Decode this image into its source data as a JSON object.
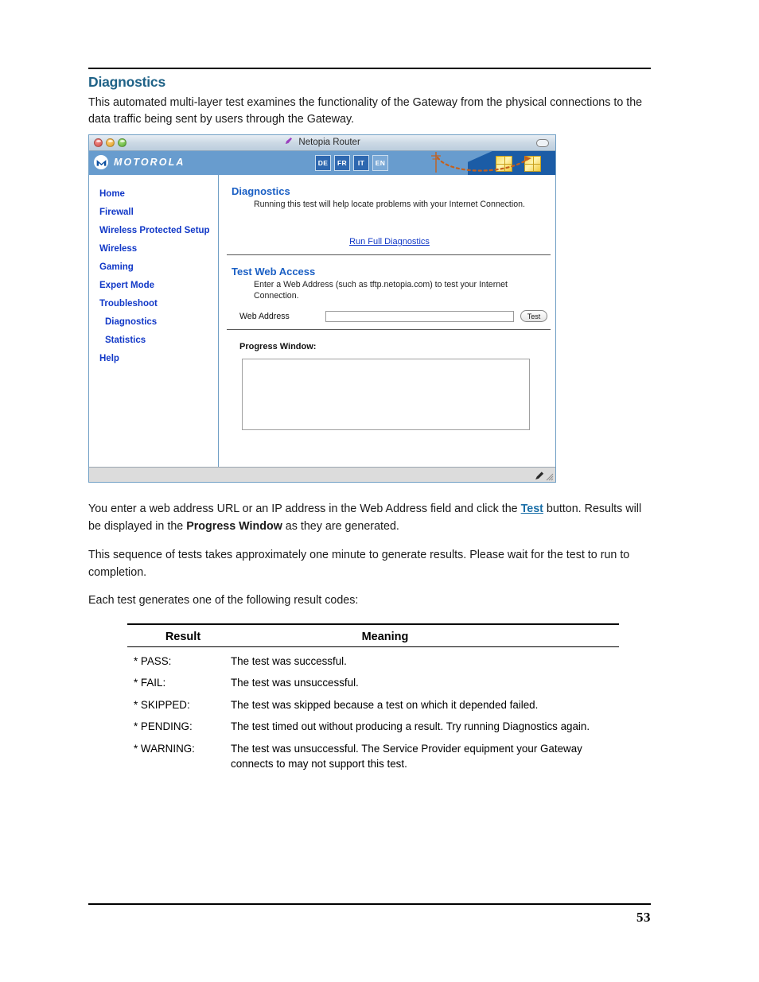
{
  "document": {
    "page_number": "53",
    "section_title": "Diagnostics",
    "intro_paragraph": "This automated multi-layer test examines the functionality of the Gateway from the physical connections to the data traffic being sent by users through the Gateway.",
    "paragraphs": {
      "p1_before_test": "You enter a web address URL or an IP address in the Web Address field and click the ",
      "p1_test": "Test",
      "p1_mid": " button. Results will be displayed in the ",
      "p1_bold": "Progress Window",
      "p1_after": " as they are generated.",
      "p2": "This sequence of tests takes approximately one minute to generate results. Please wait for the test to run to completion.",
      "p3": "Each test generates one of the following result codes:"
    }
  },
  "screenshot": {
    "titlebar": {
      "title": "Netopia Router",
      "icon": "bookmark-icon",
      "traffic_lights": [
        "close",
        "minimize",
        "zoom"
      ],
      "toolbar_toggle": "toolbar-pill"
    },
    "banner": {
      "brand": "MOTOROLA",
      "logo_icon": "motorola-batwing-icon",
      "languages": [
        {
          "code": "DE",
          "selected": true
        },
        {
          "code": "FR",
          "selected": true
        },
        {
          "code": "IT",
          "selected": true
        },
        {
          "code": "EN",
          "selected": false
        }
      ],
      "graphic": "house-and-utility-pole-wireless-graphic",
      "banner_color": "#689CCE",
      "roof_color": "#1B5CA6",
      "window_color": "#F7DC5C"
    },
    "sidebar": {
      "items": [
        {
          "label": "Home",
          "sub": false
        },
        {
          "label": "Firewall",
          "sub": false
        },
        {
          "label": "Wireless Protected Setup",
          "sub": false
        },
        {
          "label": "Wireless",
          "sub": false
        },
        {
          "label": "Gaming",
          "sub": false
        },
        {
          "label": "Expert Mode",
          "sub": false
        },
        {
          "label": "Troubleshoot",
          "sub": false
        },
        {
          "label": "Diagnostics",
          "sub": true
        },
        {
          "label": "Statistics",
          "sub": true
        },
        {
          "label": "Help",
          "sub": false
        }
      ],
      "link_color": "#1138C7"
    },
    "content": {
      "diagnostics": {
        "heading": "Diagnostics",
        "description": "Running this test will help locate problems with your Internet Connection.",
        "run_link": "Run Full Diagnostics"
      },
      "test_web_access": {
        "heading": "Test Web Access",
        "description": "Enter a Web Address (such as tftp.netopia.com) to test your Internet Connection.",
        "field_label": "Web Address",
        "field_value": "",
        "field_placeholder": "",
        "button_label": "Test"
      },
      "progress": {
        "label": "Progress Window:",
        "content": ""
      }
    },
    "statusbar": {
      "edit_icon": "pencil-icon",
      "resize_icon": "resize-grip-icon"
    }
  },
  "result_table": {
    "headers": [
      "Result",
      "Meaning"
    ],
    "rows": [
      {
        "result": "* PASS:",
        "meaning": "The test was successful."
      },
      {
        "result": "* FAIL:",
        "meaning": "The test was unsuccessful."
      },
      {
        "result": "* SKIPPED:",
        "meaning": "The test was skipped because a test on which it depended failed."
      },
      {
        "result": "* PENDING:",
        "meaning": "The test timed out without producing a result. Try running Diagnostics again."
      },
      {
        "result": "* WARNING:",
        "meaning": "The test was unsuccessful. The Service Provider equipment your Gateway connects to may not support this test."
      }
    ]
  }
}
